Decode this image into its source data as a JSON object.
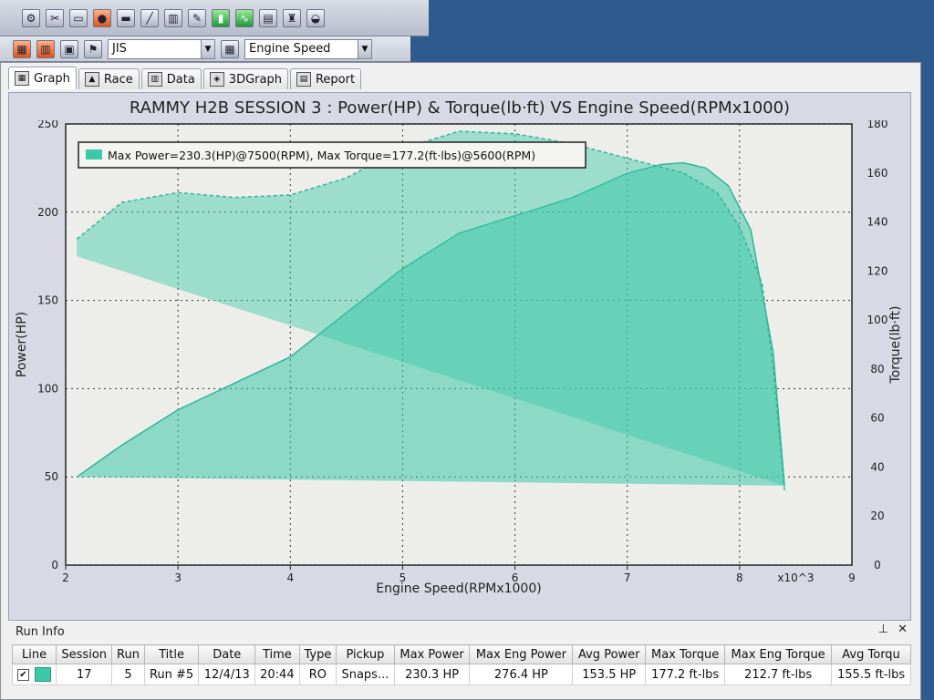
{
  "toolbar2": {
    "unit_combo": "JIS",
    "axis_combo": "Engine Speed"
  },
  "tabs": [
    {
      "label": "Graph"
    },
    {
      "label": "Race"
    },
    {
      "label": "Data"
    },
    {
      "label": "3DGraph"
    },
    {
      "label": "Report"
    }
  ],
  "colors": {
    "series_fill": "#3cc9a8",
    "series_line": "#2fb59a",
    "plot_bg": "#ededea"
  },
  "chart_data": {
    "type": "area",
    "title": "RAMMY H2B SESSION 3 : Power(HP) & Torque(lb·ft) VS Engine Speed(RPMx1000)",
    "xlabel": "Engine Speed(RPMx1000)",
    "x_multiplier": "x10^3",
    "ylabel": "Power(HP)",
    "y2label": "Torque(lb·ft)",
    "xlim": [
      2,
      9
    ],
    "ylim": [
      0,
      250
    ],
    "y2lim": [
      0,
      180
    ],
    "x_ticks": [
      "2",
      "3",
      "4",
      "5",
      "6",
      "7",
      "8"
    ],
    "y_ticks": [
      "0",
      "50",
      "100",
      "150",
      "200",
      "250"
    ],
    "y2_ticks": [
      "0",
      "20",
      "40",
      "60",
      "80",
      "100",
      "120",
      "140",
      "160",
      "180"
    ],
    "grid": true,
    "legend_text": "Max Power=230.3(HP)@7500(RPM), Max Torque=177.2(ft·lbs)@5600(RPM)",
    "legend_position": "top-left",
    "series": [
      {
        "axis": "left",
        "x": [
          2.1,
          2.5,
          3.0,
          3.5,
          4.0,
          4.5,
          5.0,
          5.5,
          6.0,
          6.5,
          7.0,
          7.3,
          7.5,
          7.7,
          7.9,
          8.1,
          8.3,
          8.4
        ],
        "values": [
          50,
          68,
          88,
          103,
          118,
          143,
          168,
          188,
          198,
          208,
          222,
          227,
          228,
          225,
          215,
          190,
          120,
          45
        ]
      },
      {
        "axis": "right",
        "x": [
          2.1,
          2.5,
          3.0,
          3.5,
          4.0,
          4.5,
          5.0,
          5.5,
          6.0,
          6.5,
          7.0,
          7.5,
          7.8,
          8.0,
          8.2,
          8.3,
          8.4
        ],
        "values": [
          133,
          148,
          152,
          150,
          151,
          158,
          170,
          177,
          176,
          172,
          166,
          160,
          152,
          138,
          115,
          80,
          30
        ]
      }
    ]
  },
  "run_info": {
    "title": "Run Info",
    "pin": "⊥",
    "close": "✕",
    "columns": [
      "Line",
      "Session",
      "Run",
      "Title",
      "Date",
      "Time",
      "Type",
      "Pickup",
      "Max Power",
      "Max Eng Power",
      "Avg Power",
      "Max Torque",
      "Max Eng Torque",
      "Avg Torqu"
    ],
    "rows": [
      {
        "line": "✔",
        "session": "17",
        "run": "5",
        "title": "Run #5",
        "date": "12/4/13",
        "time": "20:44",
        "type": "RO",
        "pickup": "Snaps...",
        "max_power": "230.3 HP",
        "max_eng_power": "276.4 HP",
        "avg_power": "153.5 HP",
        "max_torque": "177.2 ft-lbs",
        "max_eng_torque": "212.7 ft-lbs",
        "avg_torque": "155.5 ft-lbs"
      }
    ]
  }
}
